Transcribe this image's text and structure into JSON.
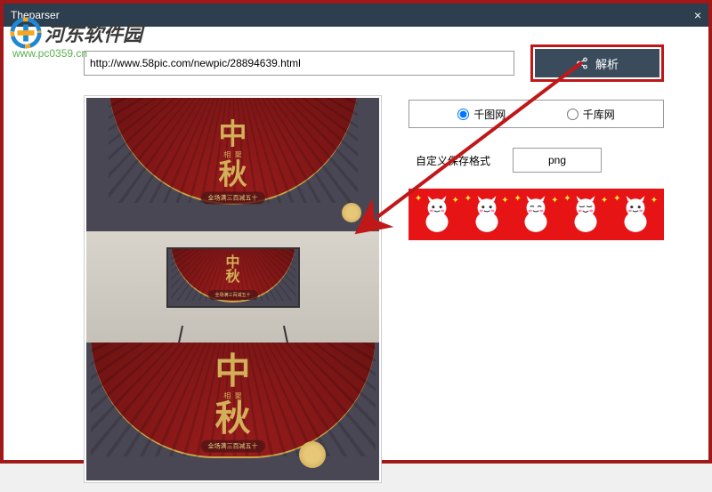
{
  "window": {
    "title": "Theparser"
  },
  "watermark": {
    "name": "河东软件园",
    "url": "www.pc0359.cn"
  },
  "url_input": {
    "value": "http://www.58pic.com/newpic/28894639.html"
  },
  "parse_button": {
    "label": "解析"
  },
  "source_radio": {
    "options": [
      {
        "label": "千图网",
        "value": "qiantu",
        "checked": true
      },
      {
        "label": "千库网",
        "value": "qianku",
        "checked": false
      }
    ]
  },
  "format": {
    "label": "自定义保存格式",
    "value": "png"
  },
  "poster": {
    "title_top": "中",
    "title_bottom": "秋",
    "subtitle_left": "相",
    "subtitle_right": "聚",
    "banner": "全场满三百减五十"
  }
}
